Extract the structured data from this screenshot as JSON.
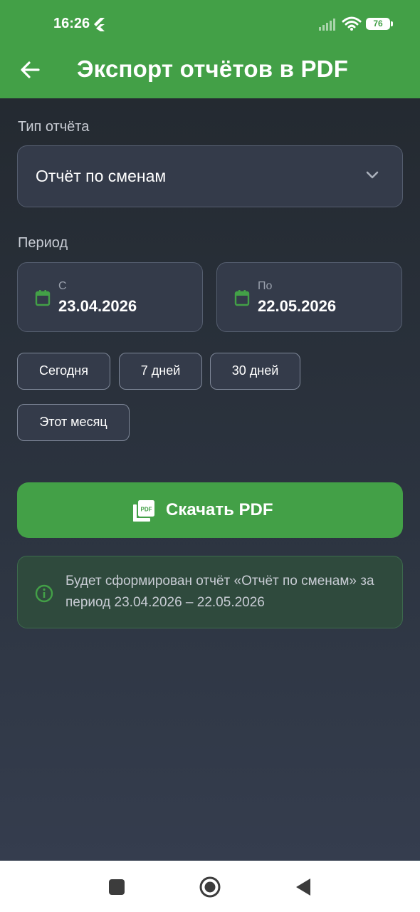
{
  "status_bar": {
    "time": "16:26",
    "battery": "76"
  },
  "header": {
    "title": "Экспорт отчётов в PDF"
  },
  "report_type": {
    "label": "Тип отчёта",
    "selected": "Отчёт по сменам"
  },
  "period": {
    "label": "Период",
    "from_label": "С",
    "from_value": "23.04.2026",
    "to_label": "По",
    "to_value": "22.05.2026",
    "presets": [
      "Сегодня",
      "7 дней",
      "30 дней",
      "Этот месяц"
    ]
  },
  "download_button": {
    "label": "Скачать PDF"
  },
  "info": {
    "text": "Будет сформирован отчёт «Отчёт по сменам» за период 23.04.2026 – 22.05.2026"
  },
  "colors": {
    "accent": "#43a047",
    "background": "#2c3440",
    "field": "#343b4a"
  }
}
